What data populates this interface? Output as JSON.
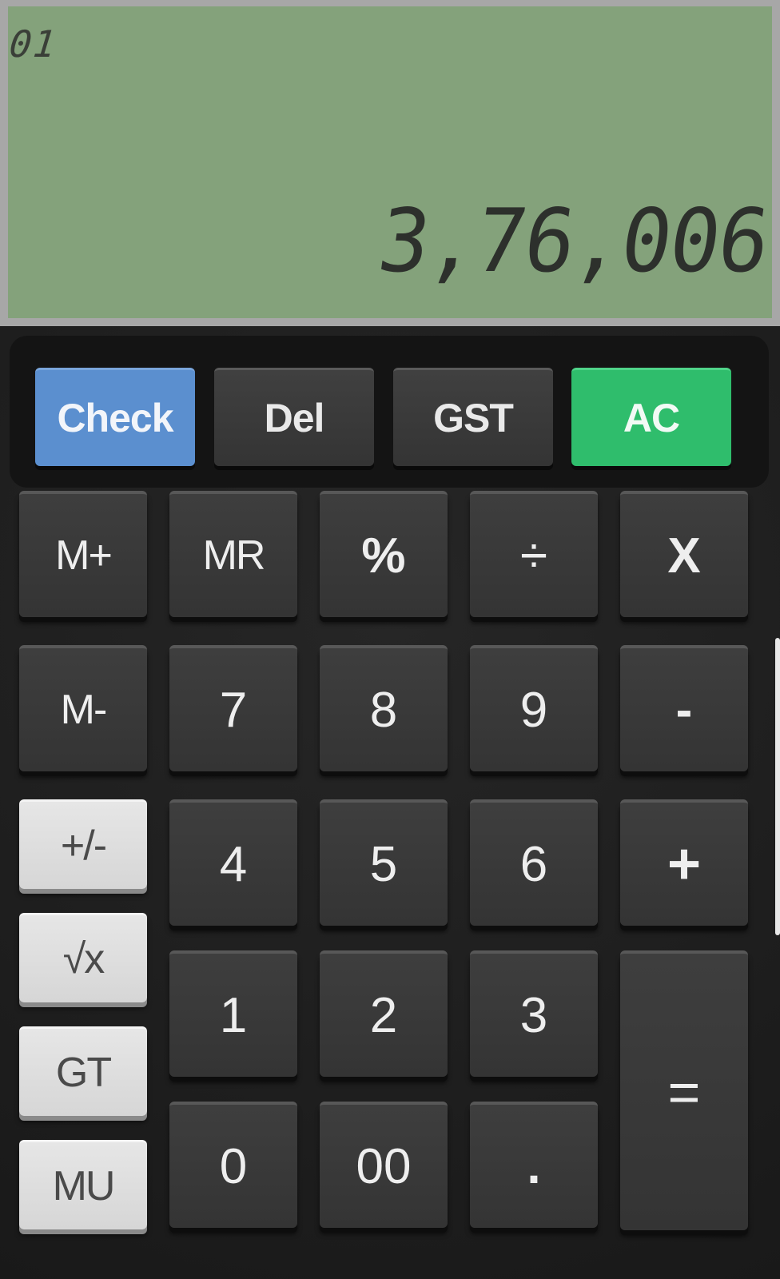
{
  "display": {
    "step_counter": "01",
    "value": "3,76,006"
  },
  "function_row": {
    "check": "Check",
    "del": "Del",
    "gst": "GST",
    "ac": "AC"
  },
  "keys": {
    "m_plus": "M+",
    "mr": "MR",
    "percent": "%",
    "divide": "÷",
    "multiply": "X",
    "m_minus": "M-",
    "seven": "7",
    "eight": "8",
    "nine": "9",
    "minus": "-",
    "plus_minus": "+/-",
    "four": "4",
    "five": "5",
    "six": "6",
    "plus": "+",
    "sqrt": "√x",
    "one": "1",
    "two": "2",
    "three": "3",
    "equals": "=",
    "gt": "GT",
    "zero": "0",
    "double_zero": "00",
    "decimal": ".",
    "mu": "MU"
  },
  "colors": {
    "display_bg": "#84a27b",
    "check_button": "#5b8fcf",
    "ac_button": "#2fbd6c",
    "key_dark": "#3a3a3a",
    "key_light": "#dedede"
  }
}
